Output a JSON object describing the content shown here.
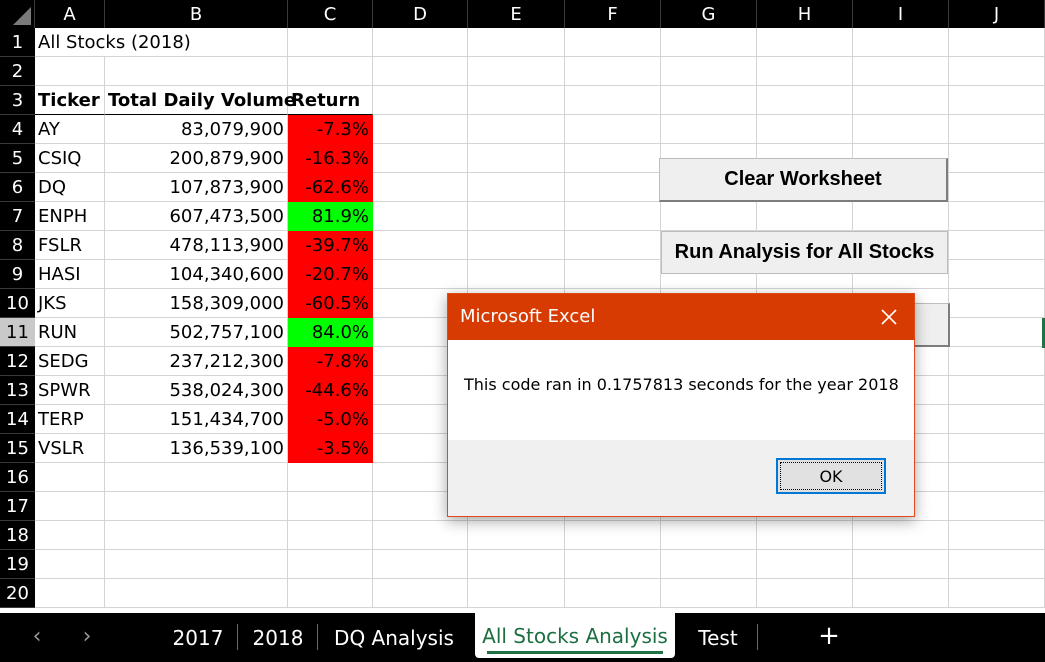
{
  "columns": [
    "A",
    "B",
    "C",
    "D",
    "E",
    "F",
    "G",
    "H",
    "I",
    "J"
  ],
  "rows": [
    "1",
    "2",
    "3",
    "4",
    "5",
    "6",
    "7",
    "8",
    "9",
    "10",
    "11",
    "12",
    "13",
    "14",
    "15",
    "16",
    "17",
    "18",
    "19",
    "20"
  ],
  "sheet": {
    "title": "All Stocks (2018)",
    "headers": {
      "ticker": "Ticker",
      "volume": "Total Daily Volume",
      "return": "Return"
    },
    "stocks": [
      {
        "ticker": "AY",
        "volume": "83,079,900",
        "return": "-7.3%",
        "positive": false
      },
      {
        "ticker": "CSIQ",
        "volume": "200,879,900",
        "return": "-16.3%",
        "positive": false
      },
      {
        "ticker": "DQ",
        "volume": "107,873,900",
        "return": "-62.6%",
        "positive": false
      },
      {
        "ticker": "ENPH",
        "volume": "607,473,500",
        "return": "81.9%",
        "positive": true
      },
      {
        "ticker": "FSLR",
        "volume": "478,113,900",
        "return": "-39.7%",
        "positive": false
      },
      {
        "ticker": "HASI",
        "volume": "104,340,600",
        "return": "-20.7%",
        "positive": false
      },
      {
        "ticker": "JKS",
        "volume": "158,309,000",
        "return": "-60.5%",
        "positive": false
      },
      {
        "ticker": "RUN",
        "volume": "502,757,100",
        "return": "84.0%",
        "positive": true
      },
      {
        "ticker": "SEDG",
        "volume": "237,212,300",
        "return": "-7.8%",
        "positive": false
      },
      {
        "ticker": "SPWR",
        "volume": "538,024,300",
        "return": "-44.6%",
        "positive": false
      },
      {
        "ticker": "TERP",
        "volume": "151,434,700",
        "return": "-5.0%",
        "positive": false
      },
      {
        "ticker": "VSLR",
        "volume": "136,539,100",
        "return": "-3.5%",
        "positive": false
      }
    ],
    "selected_row": "11"
  },
  "buttons": {
    "clear": "Clear Worksheet",
    "run_all": "Run Analysis for All Stocks"
  },
  "dialog": {
    "title": "Microsoft Excel",
    "message": "This code ran in 0.1757813 seconds for the year 2018",
    "ok_label": "OK"
  },
  "tabs": [
    "2017",
    "2018",
    "DQ Analysis",
    "All Stocks Analysis",
    "Test"
  ],
  "active_tab": "All Stocks Analysis",
  "colors": {
    "negative_fill": "#ff0000",
    "positive_fill": "#00ff00",
    "dialog_title": "#d83b01",
    "active_tab_accent": "#217346"
  },
  "icons": {
    "close": "close-icon",
    "prev": "chevron-left-icon",
    "next": "chevron-right-icon",
    "add": "plus-icon"
  }
}
